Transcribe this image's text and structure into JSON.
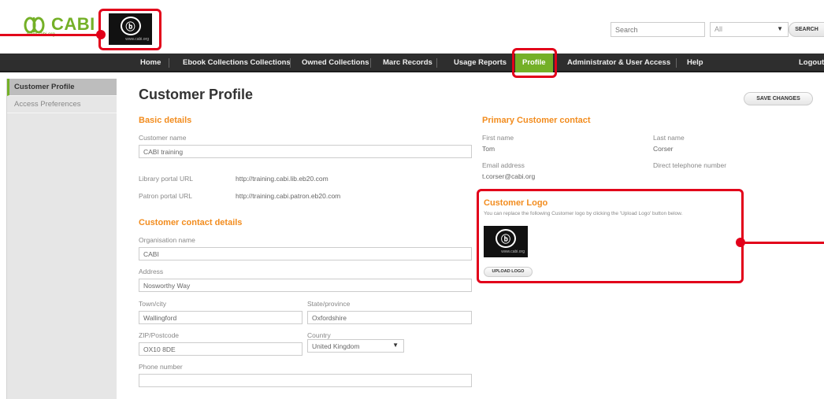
{
  "header": {
    "brand_name": "CABI",
    "brand_sub": "www.cabi.org",
    "customer_logo_glyph": "ⓑ",
    "customer_logo_url": "www.cabi.org",
    "search": {
      "value": "",
      "placeholder": "Search"
    },
    "scope": {
      "selected": "All"
    },
    "search_button": "SEARCH"
  },
  "nav": {
    "items": [
      {
        "label": "Home"
      },
      {
        "label": "Ebook Collections Collections"
      },
      {
        "label": "Owned Collections"
      },
      {
        "label": "Marc Records"
      },
      {
        "label": "Usage Reports"
      },
      {
        "label": "Profile",
        "active": true
      },
      {
        "label": "Administrator & User Access"
      },
      {
        "label": "Help"
      },
      {
        "label": "Logout"
      }
    ]
  },
  "sidebar": {
    "items": [
      {
        "label": "Customer Profile",
        "active": true
      },
      {
        "label": "Access Preferences"
      }
    ]
  },
  "main": {
    "title": "Customer Profile",
    "save_button": "SAVE CHANGES",
    "basic_details": {
      "heading": "Basic details",
      "customer_name_label": "Customer name",
      "customer_name_value": "CABI training",
      "library_portal_label": "Library portal URL",
      "library_portal_value": "http://training.cabi.lib.eb20.com",
      "patron_portal_label": "Patron portal URL",
      "patron_portal_value": "http://training.cabi.patron.eb20.com"
    },
    "contact_details": {
      "heading": "Customer contact details",
      "organisation_label": "Organisation name",
      "organisation_value": "CABI",
      "address_label": "Address",
      "address_value": "Nosworthy Way",
      "town_label": "Town/city",
      "town_value": "Wallingford",
      "state_label": "State/province",
      "state_value": "Oxfordshire",
      "zip_label": "ZIP/Postcode",
      "zip_value": "OX10 8DE",
      "country_label": "Country",
      "country_value": "United Kingdom",
      "phone_label": "Phone number",
      "phone_value": ""
    },
    "primary_contact": {
      "heading": "Primary Customer contact",
      "first_name_label": "First name",
      "first_name_value": "Tom",
      "last_name_label": "Last name",
      "last_name_value": "Corser",
      "email_label": "Email address",
      "email_value": "t.corser@cabi.org",
      "phone_label": "Direct telephone number"
    },
    "customer_logo": {
      "heading": "Customer Logo",
      "description": "You can replace the following Customer logo by clicking the 'Upload Logo' button below.",
      "logo_glyph": "ⓑ",
      "logo_url": "www.cabi.org",
      "upload_button": "UPLOAD LOGO"
    }
  },
  "colors": {
    "accent_green": "#74b027",
    "heading_orange": "#f28c1e",
    "nav_bg": "#2e2e2e",
    "callout_red": "#e2001a"
  }
}
